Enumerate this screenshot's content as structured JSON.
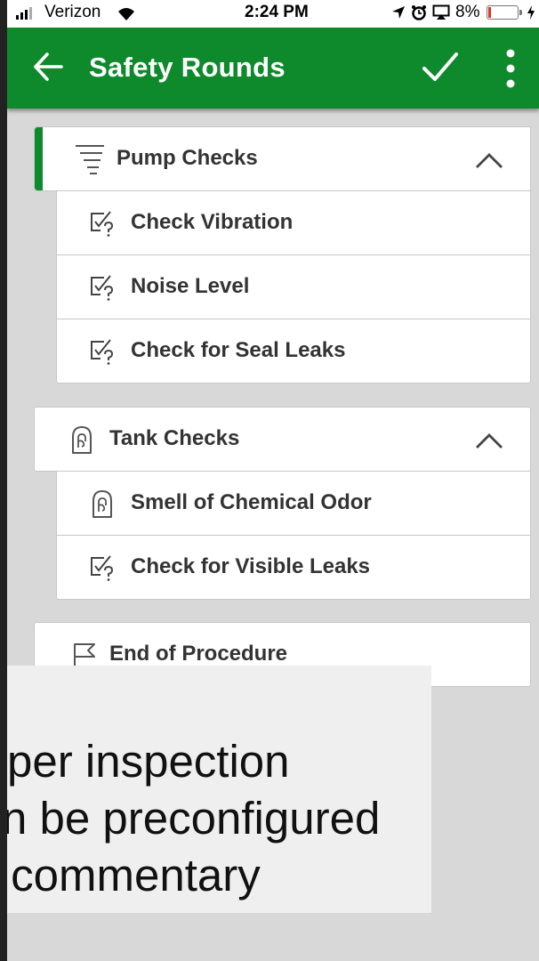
{
  "status_bar": {
    "carrier": "Verizon",
    "time": "2:24 PM",
    "battery": "8%",
    "battery_level_percent": 8,
    "icons": [
      "signal-icon",
      "wifi-icon",
      "location-icon",
      "alarm-icon",
      "airplay-icon",
      "battery-icon",
      "charging-icon"
    ]
  },
  "app_bar": {
    "title": "Safety Rounds",
    "back_icon": "arrow-left-icon",
    "confirm_icon": "checkmark-icon",
    "menu_icon": "more-vertical-icon",
    "color": "#0e8a2c"
  },
  "groups": [
    {
      "label": "Pump Checks",
      "icon": "list-filter-icon",
      "expanded": true,
      "items": [
        {
          "label": "Check Vibration",
          "icon": "checkbox-question-icon"
        },
        {
          "label": "Noise Level",
          "icon": "checkbox-question-icon"
        },
        {
          "label": "Check for Seal Leaks",
          "icon": "checkbox-question-icon"
        }
      ]
    },
    {
      "label": "Tank Checks",
      "icon": "hand-icon",
      "expanded": true,
      "items": [
        {
          "label": "Smell of Chemical Odor",
          "icon": "hand-icon"
        },
        {
          "label": "Check for Visible Leaks",
          "icon": "checkbox-question-icon"
        }
      ]
    }
  ],
  "end_item": {
    "label": "End of Procedure",
    "icon": "flag-icon"
  },
  "caption": {
    "line1": "per inspection",
    "line2": "n be preconfigured",
    "line3": " commentary"
  }
}
